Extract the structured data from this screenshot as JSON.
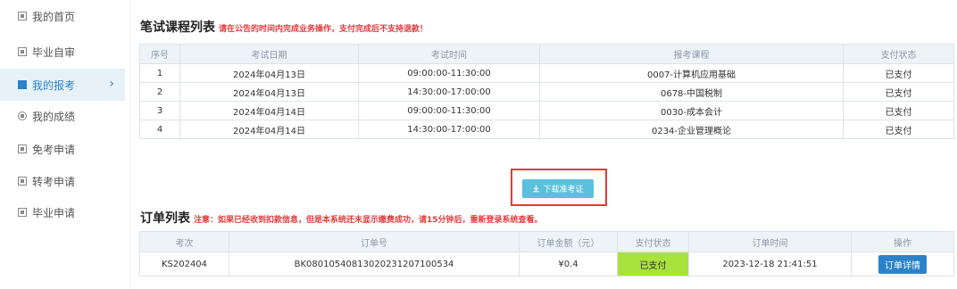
{
  "sidebar": {
    "items": [
      {
        "label": "我的首页",
        "icon": "home-icon"
      },
      {
        "label": "毕业自审",
        "icon": "document-icon"
      },
      {
        "label": "我的报考",
        "icon": "document-icon"
      },
      {
        "label": "我的成绩",
        "icon": "user-icon"
      },
      {
        "label": "免考申请",
        "icon": "document-icon"
      },
      {
        "label": "转考申请",
        "icon": "document-icon"
      },
      {
        "label": "毕业申请",
        "icon": "document-icon"
      }
    ],
    "active_index": 2,
    "chevron": "›"
  },
  "exam_section": {
    "title": "笔试课程列表",
    "note": "请在公告的时间内完成业务操作，支付完成后不支持退款！",
    "headers": [
      "序号",
      "考试日期",
      "考试时间",
      "报考课程",
      "支付状态"
    ],
    "rows": [
      [
        "1",
        "2024年04月13日",
        "09:00:00-11:30:00",
        "0007-计算机应用基础",
        "已支付"
      ],
      [
        "2",
        "2024年04月13日",
        "14:30:00-17:00:00",
        "0678-中国税制",
        "已支付"
      ],
      [
        "3",
        "2024年04月14日",
        "09:00:00-11:30:00",
        "0030-成本会计",
        "已支付"
      ],
      [
        "4",
        "2024年04月14日",
        "14:30:00-17:00:00",
        "0234-企业管理概论",
        "已支付"
      ]
    ]
  },
  "download": {
    "label": "下载准考证",
    "icon": "download-icon"
  },
  "order_section": {
    "title": "订单列表",
    "note": "注意：如果已经收到扣款信息，但是本系统还未显示缴费成功，请15分钟后，重新登录系统查看。",
    "headers": [
      "考次",
      "订单号",
      "订单金额（元）",
      "支付状态",
      "订单时间",
      "操作"
    ],
    "rows": [
      [
        "KS202404",
        "BK080105408130202312071005​34",
        "¥0.4",
        "已支付",
        "2023-12-18 21:41:51",
        "订单详情"
      ]
    ]
  },
  "colors": {
    "accent": "#2c82c9",
    "paid_bg": "#a8e23c",
    "warning": "#e4393c",
    "download_btn": "#5bc0de"
  }
}
